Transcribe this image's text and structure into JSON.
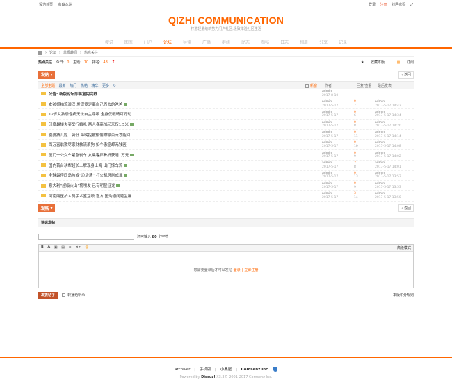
{
  "topbar": {
    "left": [
      "设为首页",
      "收藏本站"
    ],
    "right": {
      "login": "登录",
      "register": "注册",
      "forgot": "找回密码",
      "expand_icon": "expand-icon"
    }
  },
  "header": {
    "logo": "QIZHI COMMUNICATION",
    "slogan": "打造轻量级新势力门户社区,极致体验社区生活"
  },
  "nav": [
    "搜说",
    "图库",
    "门户",
    "论坛",
    "导读",
    "广播",
    "群组",
    "动态",
    "淘帖",
    "日志",
    "相册",
    "分享",
    "记录"
  ],
  "nav_active_index": 3,
  "breadcrumb": [
    "论坛",
    "草根趣闻",
    "热点关注"
  ],
  "forum": {
    "title": "热点关注",
    "today_label": "今日:",
    "today": "0",
    "topics_label": "主题:",
    "topics": "10",
    "rank_label": "排名:",
    "rank": "48",
    "favorite": "收藏本版",
    "subscribe": "订阅"
  },
  "buttons": {
    "post": "发帖",
    "return": "返回"
  },
  "filters": {
    "items": [
      "全部主题",
      "最新",
      "热门",
      "热帖",
      "精华",
      "更多"
    ],
    "newwin": "新窗",
    "col_author": "作者",
    "col_reply": "回复/查看",
    "col_last": "最后发表"
  },
  "threads": [
    {
      "title": "公告: 新版论坛即将室内完线",
      "notice": true,
      "author": "admin",
      "date": "2017-8-10",
      "replies": "",
      "views": "",
      "last_user": "",
      "last_time": "",
      "img": false
    },
    {
      "title": "女孩抓拍流浪汉 发现竟是离自己而去的爸爸",
      "author": "admin",
      "date": "2017-5-17",
      "replies": "0",
      "views": "7",
      "last_user": "admin",
      "last_time": "2017-5-17 14:42",
      "img": true
    },
    {
      "title": "12岁女孩患怪病无法自主呼吸 全身仅眼睛可眨动",
      "author": "admin",
      "date": "2017-5-17",
      "replies": "0",
      "views": "6",
      "last_user": "admin",
      "last_time": "2017-5-17 14:34",
      "img": false
    },
    {
      "title": "印度最矮夫妻举行婚礼 两人身高加起来仅1.5米",
      "author": "admin",
      "date": "2017-5-17",
      "replies": "0",
      "views": "8",
      "last_user": "admin",
      "last_time": "2017-5-17 14:20",
      "img": true
    },
    {
      "title": "婆婆猜儿媳工资低 每晚控被偷偷赚够百元才能回",
      "author": "admin",
      "date": "2017-5-17",
      "replies": "0",
      "views": "11",
      "last_user": "admin",
      "last_time": "2017-5-17 14:14",
      "img": false
    },
    {
      "title": "西万富翁欺尽家财救流浪狗 如今患癌却无钱医",
      "author": "admin",
      "date": "2017-5-17",
      "replies": "0",
      "views": "10",
      "last_user": "admin",
      "last_time": "2017-5-17 14:08",
      "img": false
    },
    {
      "title": "厦门一公交车紧急刹车 女乘客摔骨折获赔1万元",
      "author": "admin",
      "date": "2017-5-17",
      "replies": "0",
      "views": "9",
      "last_user": "admin",
      "last_time": "2017-5-17 14:02",
      "img": true
    },
    {
      "title": "国内首台耕犁超长上牌现身上海 出门惊车流",
      "author": "admin",
      "date": "2017-5-17",
      "replies": "2",
      "views": "8",
      "last_user": "admin",
      "last_time": "2017-5-17 14:01",
      "img": true
    },
    {
      "title": "全球最佳四岛屿或“垃圾场” 打火机牙刷成堆",
      "author": "admin",
      "date": "2017-5-17",
      "replies": "0",
      "views": "13",
      "last_user": "admin",
      "last_time": "2017-5-17 13:53",
      "img": true
    },
    {
      "title": "意大利“超级火山”将喷发 已有明显征兆",
      "author": "admin",
      "date": "2017-5-17",
      "replies": "0",
      "views": "9",
      "last_user": "admin",
      "last_time": "2017-5-17 13:53",
      "img": true
    },
    {
      "title": "河南两医护人员手术室互殴 官方:因沟通问题生嫌",
      "author": "admin",
      "date": "2017-5-17",
      "replies": "3",
      "views": "14",
      "last_user": "admin",
      "last_time": "2017-5-17 13:50",
      "img": false
    }
  ],
  "quick_post": {
    "title": "快速发帖",
    "remaining_pre": "还可输入",
    "remaining_num": "80",
    "remaining_post": "个字符",
    "toolbar": [
      "B",
      "A",
      "▣",
      "▤",
      "∞",
      "<>",
      "☺"
    ],
    "advanced": "高级模式",
    "need_login": "您需要登录后才可以发帖",
    "login": "登录",
    "sep": "|",
    "register": "立即注册",
    "submit": "发表帖子",
    "notify": "转播给听众",
    "rules": "本版积分规则"
  },
  "footer": {
    "links": [
      "Archiver",
      "|",
      "手机版",
      "|",
      "小黑屋",
      "|",
      "Comsenz Inc."
    ],
    "powered_pre": "Powered by",
    "brand": "Discuz!",
    "powered_post": "X3.3© 2001-2017 Comsenz Inc."
  },
  "colors": {
    "accent": "#ff6600",
    "button": "#e8703a",
    "link": "#336699"
  }
}
